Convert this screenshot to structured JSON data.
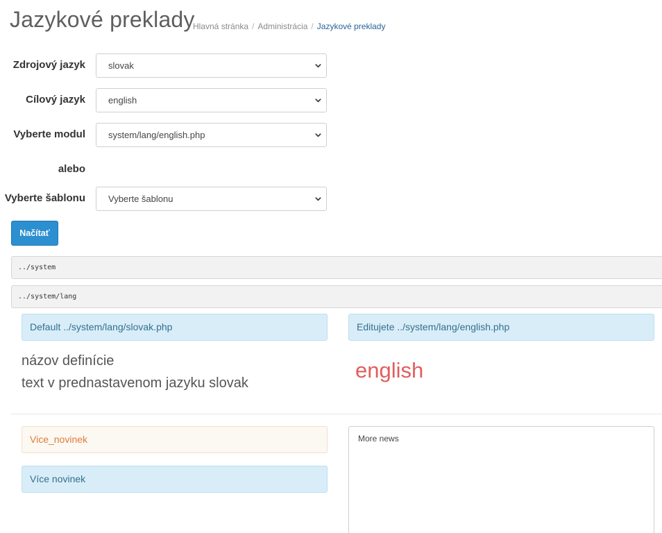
{
  "header": {
    "title": "Jazykové preklady",
    "breadcrumb": [
      "Hlavná stránka",
      "Administrácia",
      "Jazykové preklady"
    ]
  },
  "form": {
    "source_label": "Zdrojový jazyk",
    "source_value": "slovak",
    "target_label": "Cílový jazyk",
    "target_value": "english",
    "module_label": "Vyberte modul",
    "module_value": "system/lang/english.php",
    "or_label": "alebo",
    "template_label": "Vyberte šablonu",
    "template_value": "Vyberte šablonu",
    "load_button": "Načítať"
  },
  "paths": [
    "../system",
    "../system/lang"
  ],
  "translation": {
    "default_header": "Default ../system/lang/slovak.php",
    "edit_header": "Editujete ../system/lang/english.php",
    "definition_name_caption": "názov definície",
    "default_text_caption": "text v prednastavenom jazyku slovak",
    "target_language": "english",
    "entries": [
      {
        "key": "Vice_novinek",
        "default_text": "Více novinek",
        "translation": "More news"
      }
    ]
  },
  "icons": {
    "select_chevron": "chevron-down-icon"
  },
  "colors": {
    "primary_button": "#2b8fd0",
    "info_bg": "#d9edf8",
    "warn_text": "#e07b3c",
    "language_highlight": "#e35d5d"
  }
}
